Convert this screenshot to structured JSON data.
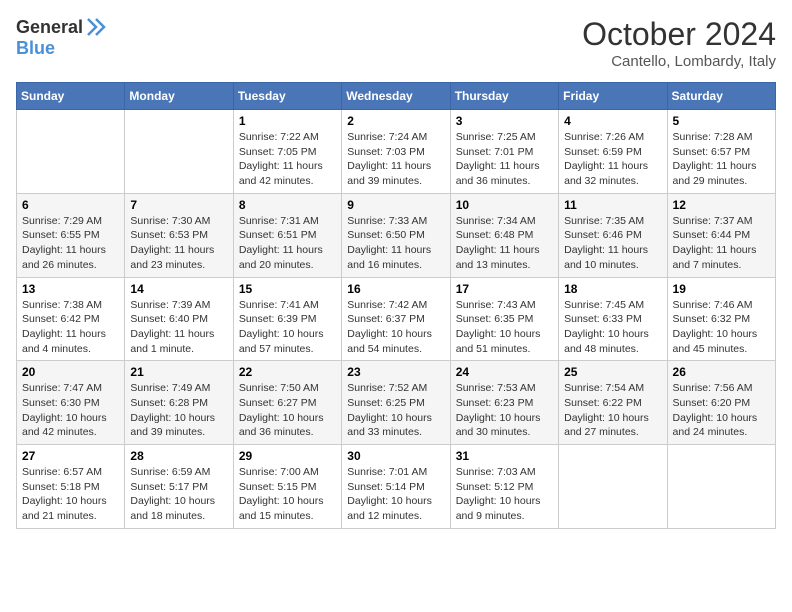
{
  "header": {
    "logo_general": "General",
    "logo_blue": "Blue",
    "title": "October 2024",
    "location": "Cantello, Lombardy, Italy"
  },
  "weekdays": [
    "Sunday",
    "Monday",
    "Tuesday",
    "Wednesday",
    "Thursday",
    "Friday",
    "Saturday"
  ],
  "weeks": [
    [
      {
        "day": "",
        "info": ""
      },
      {
        "day": "",
        "info": ""
      },
      {
        "day": "1",
        "sunrise": "7:22 AM",
        "sunset": "7:05 PM",
        "daylight": "11 hours and 42 minutes."
      },
      {
        "day": "2",
        "sunrise": "7:24 AM",
        "sunset": "7:03 PM",
        "daylight": "11 hours and 39 minutes."
      },
      {
        "day": "3",
        "sunrise": "7:25 AM",
        "sunset": "7:01 PM",
        "daylight": "11 hours and 36 minutes."
      },
      {
        "day": "4",
        "sunrise": "7:26 AM",
        "sunset": "6:59 PM",
        "daylight": "11 hours and 32 minutes."
      },
      {
        "day": "5",
        "sunrise": "7:28 AM",
        "sunset": "6:57 PM",
        "daylight": "11 hours and 29 minutes."
      }
    ],
    [
      {
        "day": "6",
        "sunrise": "7:29 AM",
        "sunset": "6:55 PM",
        "daylight": "11 hours and 26 minutes."
      },
      {
        "day": "7",
        "sunrise": "7:30 AM",
        "sunset": "6:53 PM",
        "daylight": "11 hours and 23 minutes."
      },
      {
        "day": "8",
        "sunrise": "7:31 AM",
        "sunset": "6:51 PM",
        "daylight": "11 hours and 20 minutes."
      },
      {
        "day": "9",
        "sunrise": "7:33 AM",
        "sunset": "6:50 PM",
        "daylight": "11 hours and 16 minutes."
      },
      {
        "day": "10",
        "sunrise": "7:34 AM",
        "sunset": "6:48 PM",
        "daylight": "11 hours and 13 minutes."
      },
      {
        "day": "11",
        "sunrise": "7:35 AM",
        "sunset": "6:46 PM",
        "daylight": "11 hours and 10 minutes."
      },
      {
        "day": "12",
        "sunrise": "7:37 AM",
        "sunset": "6:44 PM",
        "daylight": "11 hours and 7 minutes."
      }
    ],
    [
      {
        "day": "13",
        "sunrise": "7:38 AM",
        "sunset": "6:42 PM",
        "daylight": "11 hours and 4 minutes."
      },
      {
        "day": "14",
        "sunrise": "7:39 AM",
        "sunset": "6:40 PM",
        "daylight": "11 hours and 1 minute."
      },
      {
        "day": "15",
        "sunrise": "7:41 AM",
        "sunset": "6:39 PM",
        "daylight": "10 hours and 57 minutes."
      },
      {
        "day": "16",
        "sunrise": "7:42 AM",
        "sunset": "6:37 PM",
        "daylight": "10 hours and 54 minutes."
      },
      {
        "day": "17",
        "sunrise": "7:43 AM",
        "sunset": "6:35 PM",
        "daylight": "10 hours and 51 minutes."
      },
      {
        "day": "18",
        "sunrise": "7:45 AM",
        "sunset": "6:33 PM",
        "daylight": "10 hours and 48 minutes."
      },
      {
        "day": "19",
        "sunrise": "7:46 AM",
        "sunset": "6:32 PM",
        "daylight": "10 hours and 45 minutes."
      }
    ],
    [
      {
        "day": "20",
        "sunrise": "7:47 AM",
        "sunset": "6:30 PM",
        "daylight": "10 hours and 42 minutes."
      },
      {
        "day": "21",
        "sunrise": "7:49 AM",
        "sunset": "6:28 PM",
        "daylight": "10 hours and 39 minutes."
      },
      {
        "day": "22",
        "sunrise": "7:50 AM",
        "sunset": "6:27 PM",
        "daylight": "10 hours and 36 minutes."
      },
      {
        "day": "23",
        "sunrise": "7:52 AM",
        "sunset": "6:25 PM",
        "daylight": "10 hours and 33 minutes."
      },
      {
        "day": "24",
        "sunrise": "7:53 AM",
        "sunset": "6:23 PM",
        "daylight": "10 hours and 30 minutes."
      },
      {
        "day": "25",
        "sunrise": "7:54 AM",
        "sunset": "6:22 PM",
        "daylight": "10 hours and 27 minutes."
      },
      {
        "day": "26",
        "sunrise": "7:56 AM",
        "sunset": "6:20 PM",
        "daylight": "10 hours and 24 minutes."
      }
    ],
    [
      {
        "day": "27",
        "sunrise": "6:57 AM",
        "sunset": "5:18 PM",
        "daylight": "10 hours and 21 minutes."
      },
      {
        "day": "28",
        "sunrise": "6:59 AM",
        "sunset": "5:17 PM",
        "daylight": "10 hours and 18 minutes."
      },
      {
        "day": "29",
        "sunrise": "7:00 AM",
        "sunset": "5:15 PM",
        "daylight": "10 hours and 15 minutes."
      },
      {
        "day": "30",
        "sunrise": "7:01 AM",
        "sunset": "5:14 PM",
        "daylight": "10 hours and 12 minutes."
      },
      {
        "day": "31",
        "sunrise": "7:03 AM",
        "sunset": "5:12 PM",
        "daylight": "10 hours and 9 minutes."
      },
      {
        "day": "",
        "info": ""
      },
      {
        "day": "",
        "info": ""
      }
    ]
  ]
}
